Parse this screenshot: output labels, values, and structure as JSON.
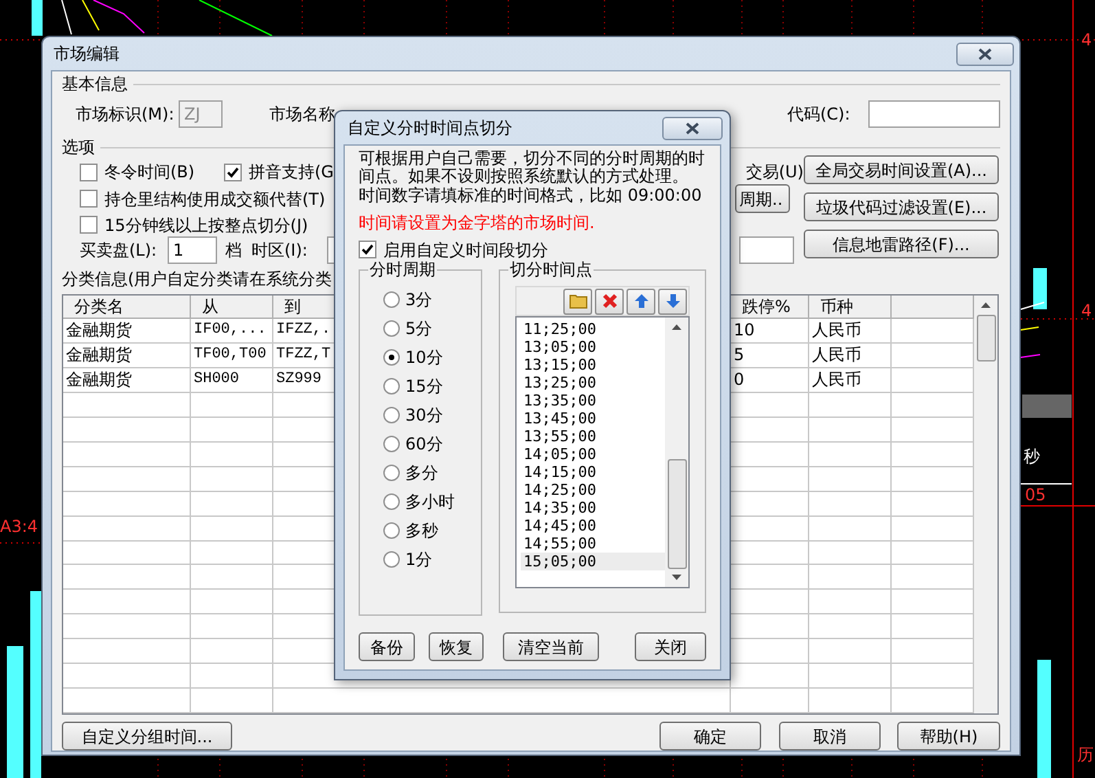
{
  "background_chart": {
    "labels": [
      {
        "text": "4"
      },
      {
        "text": "4"
      },
      {
        "text": "秒"
      },
      {
        "text": "05"
      },
      {
        "text": "A3:4"
      },
      {
        "text": "历"
      }
    ]
  },
  "main_window": {
    "title": "市场编辑",
    "basic_info": {
      "heading": "基本信息",
      "market_id_label": "市场标识(M):",
      "market_id_value": "ZJ",
      "market_name_label": "市场名称",
      "code_label": "代码(C):"
    },
    "options": {
      "heading": "选项",
      "checkboxes": [
        {
          "label": "冬令时间(B)",
          "checked": false
        },
        {
          "label": "拼音支持(G",
          "checked": true
        },
        {
          "label": "持仓里结构使用成交额代替(T)",
          "checked": false
        },
        {
          "label": "15分钟线以上按整点切分(J)",
          "checked": false
        }
      ],
      "trade_label": "交易(U)",
      "period_button": "周期..",
      "buttons": [
        "全局交易时间设置(A)...",
        "垃圾代码过滤设置(E)...",
        "信息地雷路径(F)..."
      ],
      "order_book_label": "买卖盘(L):",
      "order_book_value": "1",
      "order_book_unit": "档",
      "timezone_label": "时区(I):"
    },
    "category_info": "分类信息(用户自定分类请在系统分类",
    "table": {
      "columns_left": [
        "分类名",
        "从",
        "到"
      ],
      "columns_right": [
        "跌停%",
        "币种"
      ],
      "rows": [
        {
          "name": "金融期货",
          "from": "IF00,...",
          "to": "IFZZ,.",
          "limit_down": "10",
          "currency": "人民币"
        },
        {
          "name": "金融期货",
          "from": "TF00,T00",
          "to": "TFZZ,T",
          "limit_down": "5",
          "currency": "人民币"
        },
        {
          "name": "金融期货",
          "from": "SH000",
          "to": "SZ999",
          "limit_down": "0",
          "currency": "人民币"
        }
      ]
    },
    "buttons": [
      "自定义分组时间...",
      "确定",
      "取消",
      "帮助(H)"
    ]
  },
  "split_dialog": {
    "title": "自定义分时时间点切分",
    "description": "可根据用户自己需要，切分不同的分时周期的时间点。如果不设则按照系统默认的方式处理。",
    "format_hint": "时间数字请填标准的时间格式，比如 09:00:00",
    "warning": "时间请设置为金字塔的市场时间.",
    "enable_checkbox": {
      "label": "启用自定义时间段切分",
      "checked": true
    },
    "period_group": {
      "title": "分时周期",
      "options": [
        {
          "label": "3分",
          "selected": false
        },
        {
          "label": "5分",
          "selected": false
        },
        {
          "label": "10分",
          "selected": true
        },
        {
          "label": "15分",
          "selected": false
        },
        {
          "label": "30分",
          "selected": false
        },
        {
          "label": "60分",
          "selected": false
        },
        {
          "label": "多分",
          "selected": false
        },
        {
          "label": "多小时",
          "selected": false
        },
        {
          "label": "多秒",
          "selected": false
        },
        {
          "label": "1分",
          "selected": false
        }
      ]
    },
    "points_group": {
      "title": "切分时间点",
      "times": [
        {
          "text": "11;25;00",
          "selected": false
        },
        {
          "text": "13;05;00",
          "selected": false
        },
        {
          "text": "13;15;00",
          "selected": false
        },
        {
          "text": "13;25;00",
          "selected": false
        },
        {
          "text": "13;35;00",
          "selected": false
        },
        {
          "text": "13;45;00",
          "selected": false
        },
        {
          "text": "13;55;00",
          "selected": false
        },
        {
          "text": "14;05;00",
          "selected": false
        },
        {
          "text": "14;15;00",
          "selected": false
        },
        {
          "text": "14;25;00",
          "selected": false
        },
        {
          "text": "14;35;00",
          "selected": false
        },
        {
          "text": "14;45;00",
          "selected": false
        },
        {
          "text": "14;55;00",
          "selected": false
        },
        {
          "text": "15;05;00",
          "selected": true
        }
      ]
    },
    "buttons": [
      "备份",
      "恢复",
      "清空当前",
      "关闭"
    ]
  }
}
